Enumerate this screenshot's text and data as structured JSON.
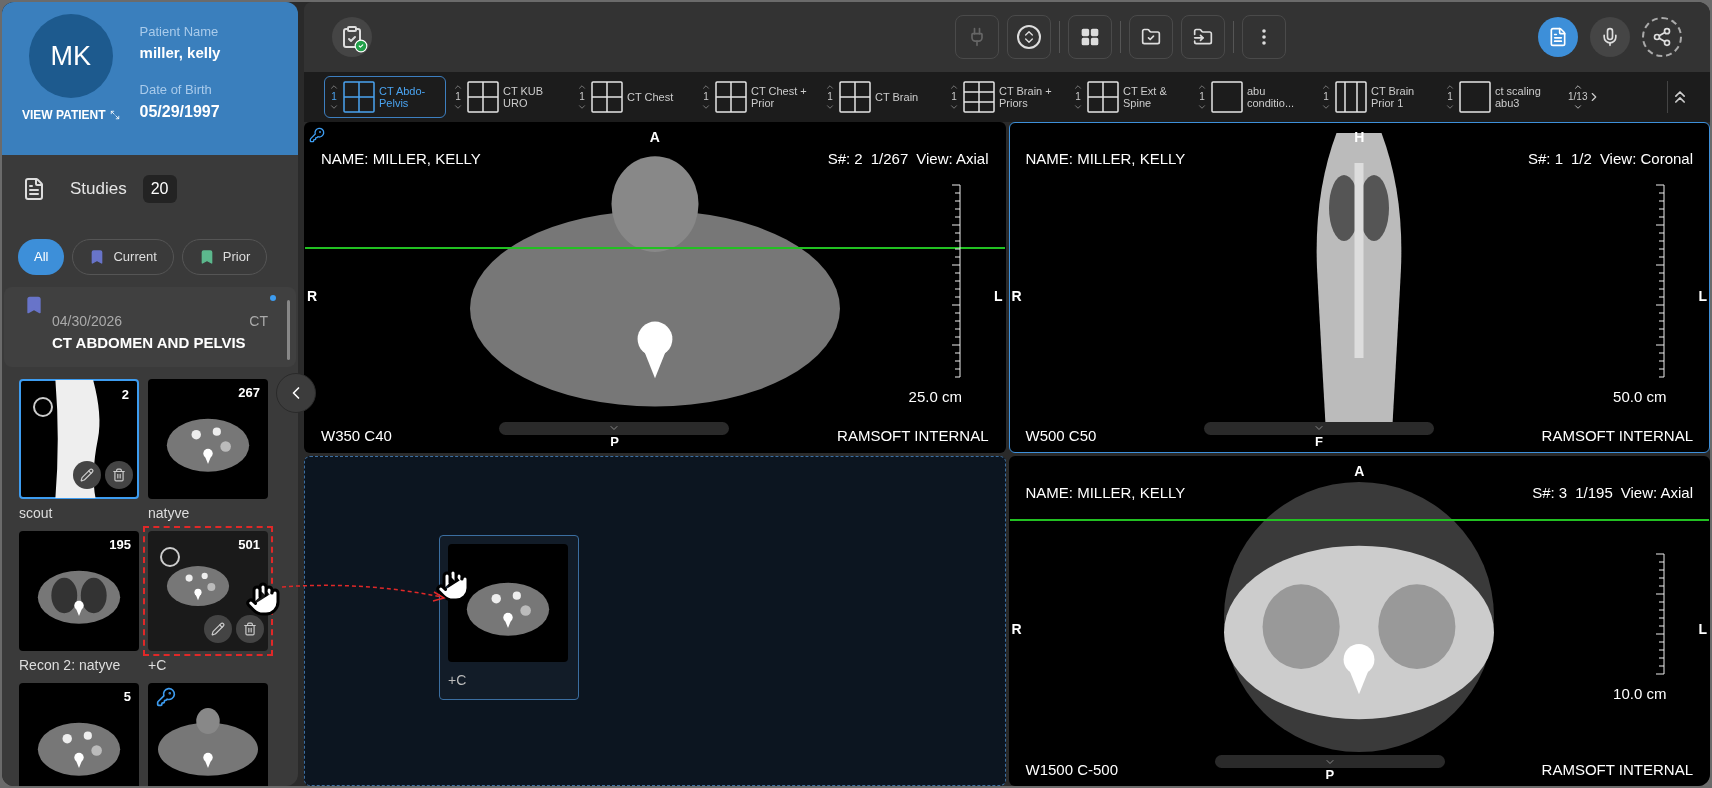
{
  "patient": {
    "initials": "MK",
    "view_link": "VIEW PATIENT",
    "name_label": "Patient Name",
    "name": "miller, kelly",
    "dob_label": "Date of Birth",
    "dob": "05/29/1997"
  },
  "studies": {
    "title": "Studies",
    "count": "20",
    "filters": [
      {
        "label": "All",
        "selected": true
      },
      {
        "label": "Current",
        "selected": false,
        "color": "#6874c9"
      },
      {
        "label": "Prior",
        "selected": false,
        "color": "#5cb88d"
      }
    ],
    "card": {
      "date": "04/30/2026",
      "modality": "CT",
      "title": "CT ABDOMEN AND PELVIS",
      "color": "#6874c9",
      "unread": true
    },
    "series": [
      {
        "label": "scout",
        "count": "2",
        "kind": "scout",
        "selected": true,
        "hovered": true,
        "dragging": false,
        "key": false
      },
      {
        "label": "natyve",
        "count": "267",
        "kind": "abdomen",
        "selected": false,
        "hovered": false,
        "dragging": false,
        "key": false
      },
      {
        "label": "Recon 2: natyve",
        "count": "195",
        "kind": "chest",
        "selected": false,
        "hovered": false,
        "dragging": false,
        "key": false
      },
      {
        "label": "+C",
        "count": "501",
        "kind": "abdomen",
        "selected": false,
        "hovered": true,
        "dragging": true,
        "key": false
      },
      {
        "count": "5",
        "kind": "abdomen",
        "selected": false,
        "hovered": false,
        "dragging": false,
        "key": false
      },
      {
        "kind": "neck",
        "selected": false,
        "hovered": false,
        "dragging": false,
        "key": true
      }
    ]
  },
  "toolbar": {
    "left": [
      {
        "kind": "clipboard-check"
      }
    ],
    "center": [
      {
        "kind": "plug",
        "disabled": true,
        "active": false
      },
      {
        "kind": "scroll",
        "disabled": false,
        "active": false
      },
      {
        "kind": "grid",
        "disabled": false,
        "active": false
      },
      {
        "kind": "folder-check",
        "disabled": false,
        "active": false
      },
      {
        "kind": "folder-import",
        "disabled": false,
        "active": false
      },
      {
        "kind": "more",
        "disabled": false,
        "active": false
      }
    ],
    "right": [
      {
        "kind": "notes",
        "disabled": false,
        "active": true
      },
      {
        "kind": "mic",
        "disabled": false,
        "active": false
      },
      {
        "kind": "share",
        "disabled": false,
        "active": false
      }
    ]
  },
  "protocols": {
    "items": [
      {
        "label": "CT Abdo-Pelvis",
        "count": "1",
        "kind": "quad",
        "selected": true
      },
      {
        "label": "CT KUB URO",
        "count": "1",
        "kind": "quad",
        "selected": false
      },
      {
        "label": "CT Chest",
        "count": "1",
        "kind": "quad",
        "selected": false
      },
      {
        "label": "CT Chest + Prior",
        "count": "1",
        "kind": "quad",
        "selected": false
      },
      {
        "label": "CT Brain",
        "count": "1",
        "kind": "quad",
        "selected": false
      },
      {
        "label": "CT Brain + Priors",
        "count": "1",
        "kind": "six",
        "selected": false
      },
      {
        "label": "CT Ext & Spine",
        "count": "1",
        "kind": "quad",
        "selected": false
      },
      {
        "label": "abu conditio...",
        "count": "1",
        "kind": "single",
        "selected": false
      },
      {
        "label": "CT Brain Prior 1",
        "count": "1",
        "kind": "columns",
        "selected": false
      },
      {
        "label": "ct scaling abu3",
        "count": "1",
        "kind": "single",
        "selected": false
      }
    ],
    "pager": "1/13"
  },
  "viewports": [
    {
      "kind": "neck",
      "selected": false,
      "key": true,
      "reference_line": true,
      "name": "NAME: MILLER, KELLY",
      "series": "S#: 2",
      "slice": "1/267",
      "view": "View: Axial",
      "window": "W350 C40",
      "institution": "RAMSOFT INTERNAL",
      "scale": "25.0 cm",
      "top": "A",
      "left": "R",
      "right": "L",
      "bottom": "P"
    },
    {
      "kind": "coronal",
      "selected": true,
      "key": false,
      "reference_line": false,
      "name": "NAME: MILLER, KELLY",
      "series": "S#: 1",
      "slice": "1/2",
      "view": "View: Coronal",
      "window": "W500 C50",
      "institution": "RAMSOFT INTERNAL",
      "scale": "50.0 cm",
      "top": "H",
      "left": "R",
      "right": "L",
      "bottom": "F"
    },
    {
      "kind": "drop",
      "ghost": {
        "label": "+C",
        "kind": "abdomen"
      }
    },
    {
      "kind": "lung",
      "selected": false,
      "key": false,
      "reference_line": true,
      "name": "NAME: MILLER, KELLY",
      "series": "S#: 3",
      "slice": "1/195",
      "view": "View: Axial",
      "window": "W1500 C-500",
      "institution": "RAMSOFT INTERNAL",
      "scale": "10.0 cm",
      "top": "A",
      "left": "R",
      "right": "L",
      "bottom": "P"
    }
  ]
}
